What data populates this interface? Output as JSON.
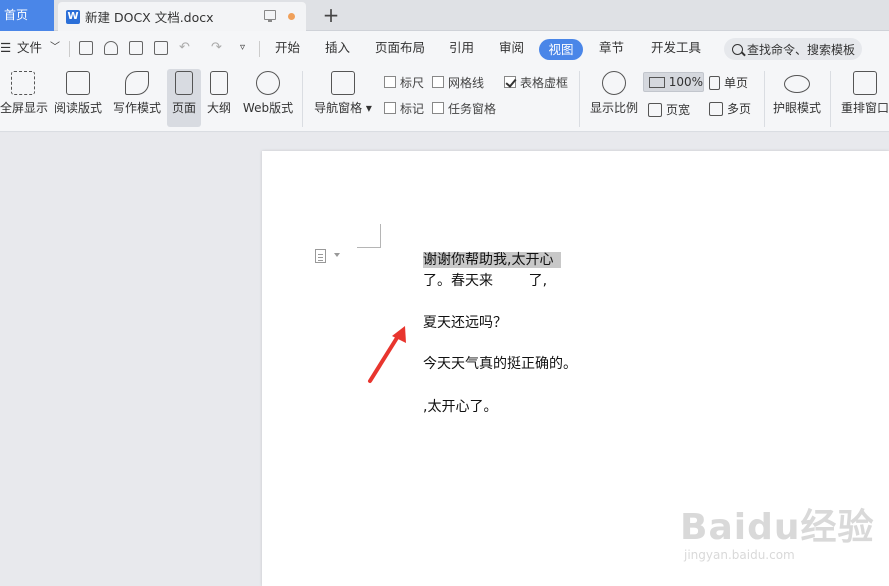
{
  "tabs": {
    "home": "首页",
    "doc_title": "新建 DOCX 文档.docx",
    "add": "+"
  },
  "menu": {
    "file": "文件",
    "items": [
      "开始",
      "插入",
      "页面布局",
      "引用",
      "审阅",
      "视图",
      "章节",
      "开发工具"
    ],
    "active": "视图",
    "search_label": "查找命令、搜索模板"
  },
  "ribbon": {
    "fullscreen": "全屏显示",
    "reading": "阅读版式",
    "writing": "写作模式",
    "page": "页面",
    "outline": "大纲",
    "web": "Web版式",
    "nav_pane": "导航窗格",
    "ruler": "标尺",
    "gridlines": "网格线",
    "table_frame": "表格虚框",
    "marks": "标记",
    "task_pane": "任务窗格",
    "zoom_label": "显示比例",
    "zoom_value": "100%",
    "page_width": "页宽",
    "single_page": "单页",
    "multi_page": "多页",
    "eye_mode": "护眼模式",
    "rearrange": "重排窗口",
    "checks": {
      "ruler": false,
      "gridlines": false,
      "table_frame": true,
      "marks": false,
      "task_pane": false
    }
  },
  "document": {
    "line1": "谢谢你帮助我,太开心",
    "line2": "了。春天来        了,",
    "line3": "夏天还远吗？",
    "line4": "今天天气真的挺正确的。",
    "line5": ",太开心了。"
  },
  "watermark": {
    "main": "Baidu经验",
    "sub": "jingyan.baidu.com"
  },
  "colors": {
    "accent": "#4a86e8",
    "arrow": "#e8352e"
  }
}
